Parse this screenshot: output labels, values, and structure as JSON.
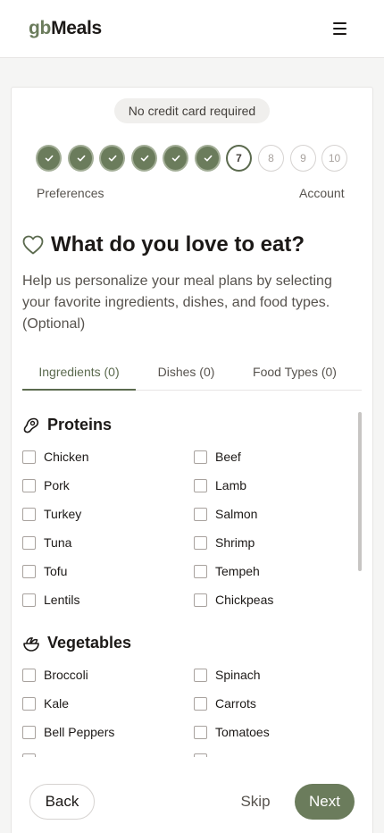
{
  "header": {
    "logo_prefix": "gb",
    "logo_suffix": "Meals",
    "menu_icon": "hamburger-icon"
  },
  "badge": "No credit card required",
  "progress": {
    "steps": [
      "1",
      "2",
      "3",
      "4",
      "5",
      "6",
      "7",
      "8",
      "9",
      "10"
    ],
    "completed_count": 6,
    "current_step": 7,
    "start_label": "Preferences",
    "end_label": "Account"
  },
  "page": {
    "title": "What do you love to eat?",
    "description": "Help us personalize your meal plans by selecting your favorite ingredients, dishes, and food types. (Optional)",
    "title_icon": "heart-icon"
  },
  "tabs": [
    {
      "label": "Ingredients (0)",
      "active": true
    },
    {
      "label": "Dishes (0)",
      "active": false
    },
    {
      "label": "Food Types (0)",
      "active": false
    }
  ],
  "sections": [
    {
      "title": "Proteins",
      "icon": "meat-icon",
      "items": [
        "Chicken",
        "Beef",
        "Pork",
        "Lamb",
        "Turkey",
        "Salmon",
        "Tuna",
        "Shrimp",
        "Tofu",
        "Tempeh",
        "Lentils",
        "Chickpeas"
      ]
    },
    {
      "title": "Vegetables",
      "icon": "salad-bowl-icon",
      "items": [
        "Broccoli",
        "Spinach",
        "Kale",
        "Carrots",
        "Bell Peppers",
        "Tomatoes"
      ]
    }
  ],
  "footer": {
    "back_label": "Back",
    "skip_label": "Skip",
    "next_label": "Next"
  },
  "colors": {
    "accent": "#6b7c5c",
    "accent_dark": "#5b6a4e"
  }
}
